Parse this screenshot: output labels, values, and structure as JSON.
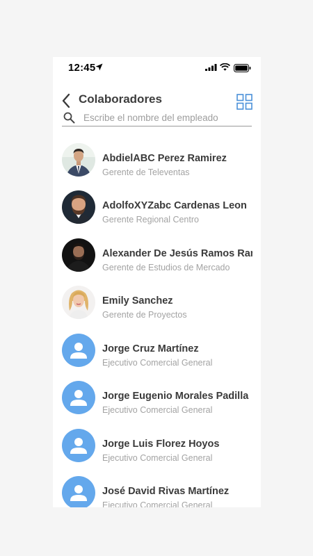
{
  "status_bar": {
    "time": "12:45"
  },
  "header": {
    "title": "Colaboradores"
  },
  "search": {
    "placeholder": "Escribe el nombre del empleado"
  },
  "employees": [
    {
      "name": "AbdielABC Perez Ramirez",
      "role": "Gerente de Televentas",
      "avatar": "photo-man-suit"
    },
    {
      "name": "AdolfoXYZabc Cardenas Leon",
      "role": "Gerente Regional Centro",
      "avatar": "photo-man-beard"
    },
    {
      "name": "Alexander De Jesús Ramos Rangel",
      "role": "Gerente de Estudios de Mercado",
      "avatar": "photo-man-dark"
    },
    {
      "name": "Emily Sanchez",
      "role": "Gerente de Proyectos",
      "avatar": "photo-woman-blonde"
    },
    {
      "name": "Jorge Cruz Martínez",
      "role": "Ejecutivo Comercial General",
      "avatar": "person-icon"
    },
    {
      "name": "Jorge Eugenio Morales Padilla",
      "role": "Ejecutivo Comercial General",
      "avatar": "person-icon"
    },
    {
      "name": "Jorge Luis Florez Hoyos",
      "role": "Ejecutivo Comercial General",
      "avatar": "person-icon"
    },
    {
      "name": "José David Rivas Martínez",
      "role": "Ejecutivo Comercial General",
      "avatar": "person-icon"
    }
  ],
  "colors": {
    "accent": "#4a90d9",
    "avatar_placeholder": "#64a8ec"
  }
}
